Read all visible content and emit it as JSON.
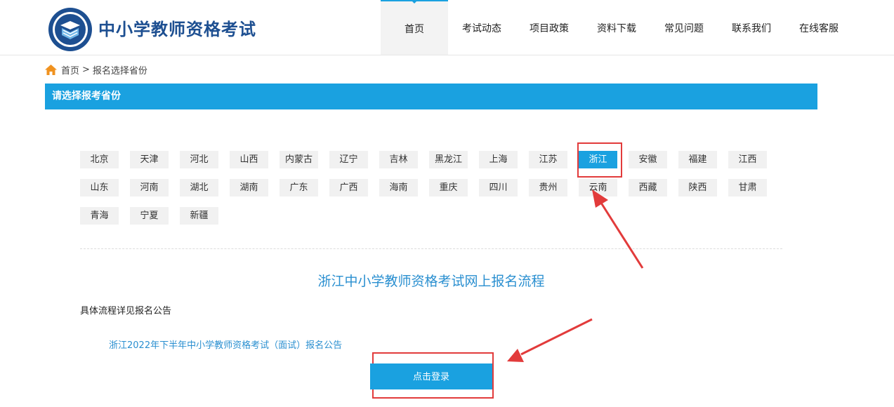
{
  "header": {
    "site_title": "中小学教师资格考试",
    "logo_icon": "teacher-certification-logo",
    "nav": [
      {
        "label": "首页",
        "active": true
      },
      {
        "label": "考试动态"
      },
      {
        "label": "项目政策"
      },
      {
        "label": "资料下载"
      },
      {
        "label": "常见问题"
      },
      {
        "label": "联系我们"
      },
      {
        "label": "在线客服"
      }
    ]
  },
  "breadcrumb": {
    "home_icon": "home-icon",
    "home": "首页",
    "separator": ">",
    "current": "报名选择省份"
  },
  "section": {
    "title": "请选择报考省份"
  },
  "provinces": {
    "row1": [
      "北京",
      "天津",
      "河北",
      "山西",
      "内蒙古",
      "辽宁",
      "吉林",
      "黑龙江",
      "上海",
      "江苏",
      "浙江",
      "安徽",
      "福建",
      "江西"
    ],
    "row2": [
      "山东",
      "河南",
      "湖北",
      "湖南",
      "广东",
      "广西",
      "海南",
      "重庆",
      "四川",
      "贵州",
      "云南",
      "西藏",
      "陕西",
      "甘肃"
    ],
    "row3": [
      "青海",
      "宁夏",
      "新疆"
    ],
    "selected": "浙江"
  },
  "content": {
    "flow_title": "浙江中小学教师资格考试网上报名流程",
    "detail_text": "具体流程详见报名公告",
    "notice_link": "浙江2022年下半年中小学教师资格考试（面试）报名公告",
    "login_button": "点击登录"
  },
  "colors": {
    "accent": "#1aa1e0",
    "title_blue": "#1d4f91",
    "annotation_red": "#e23b3b"
  }
}
